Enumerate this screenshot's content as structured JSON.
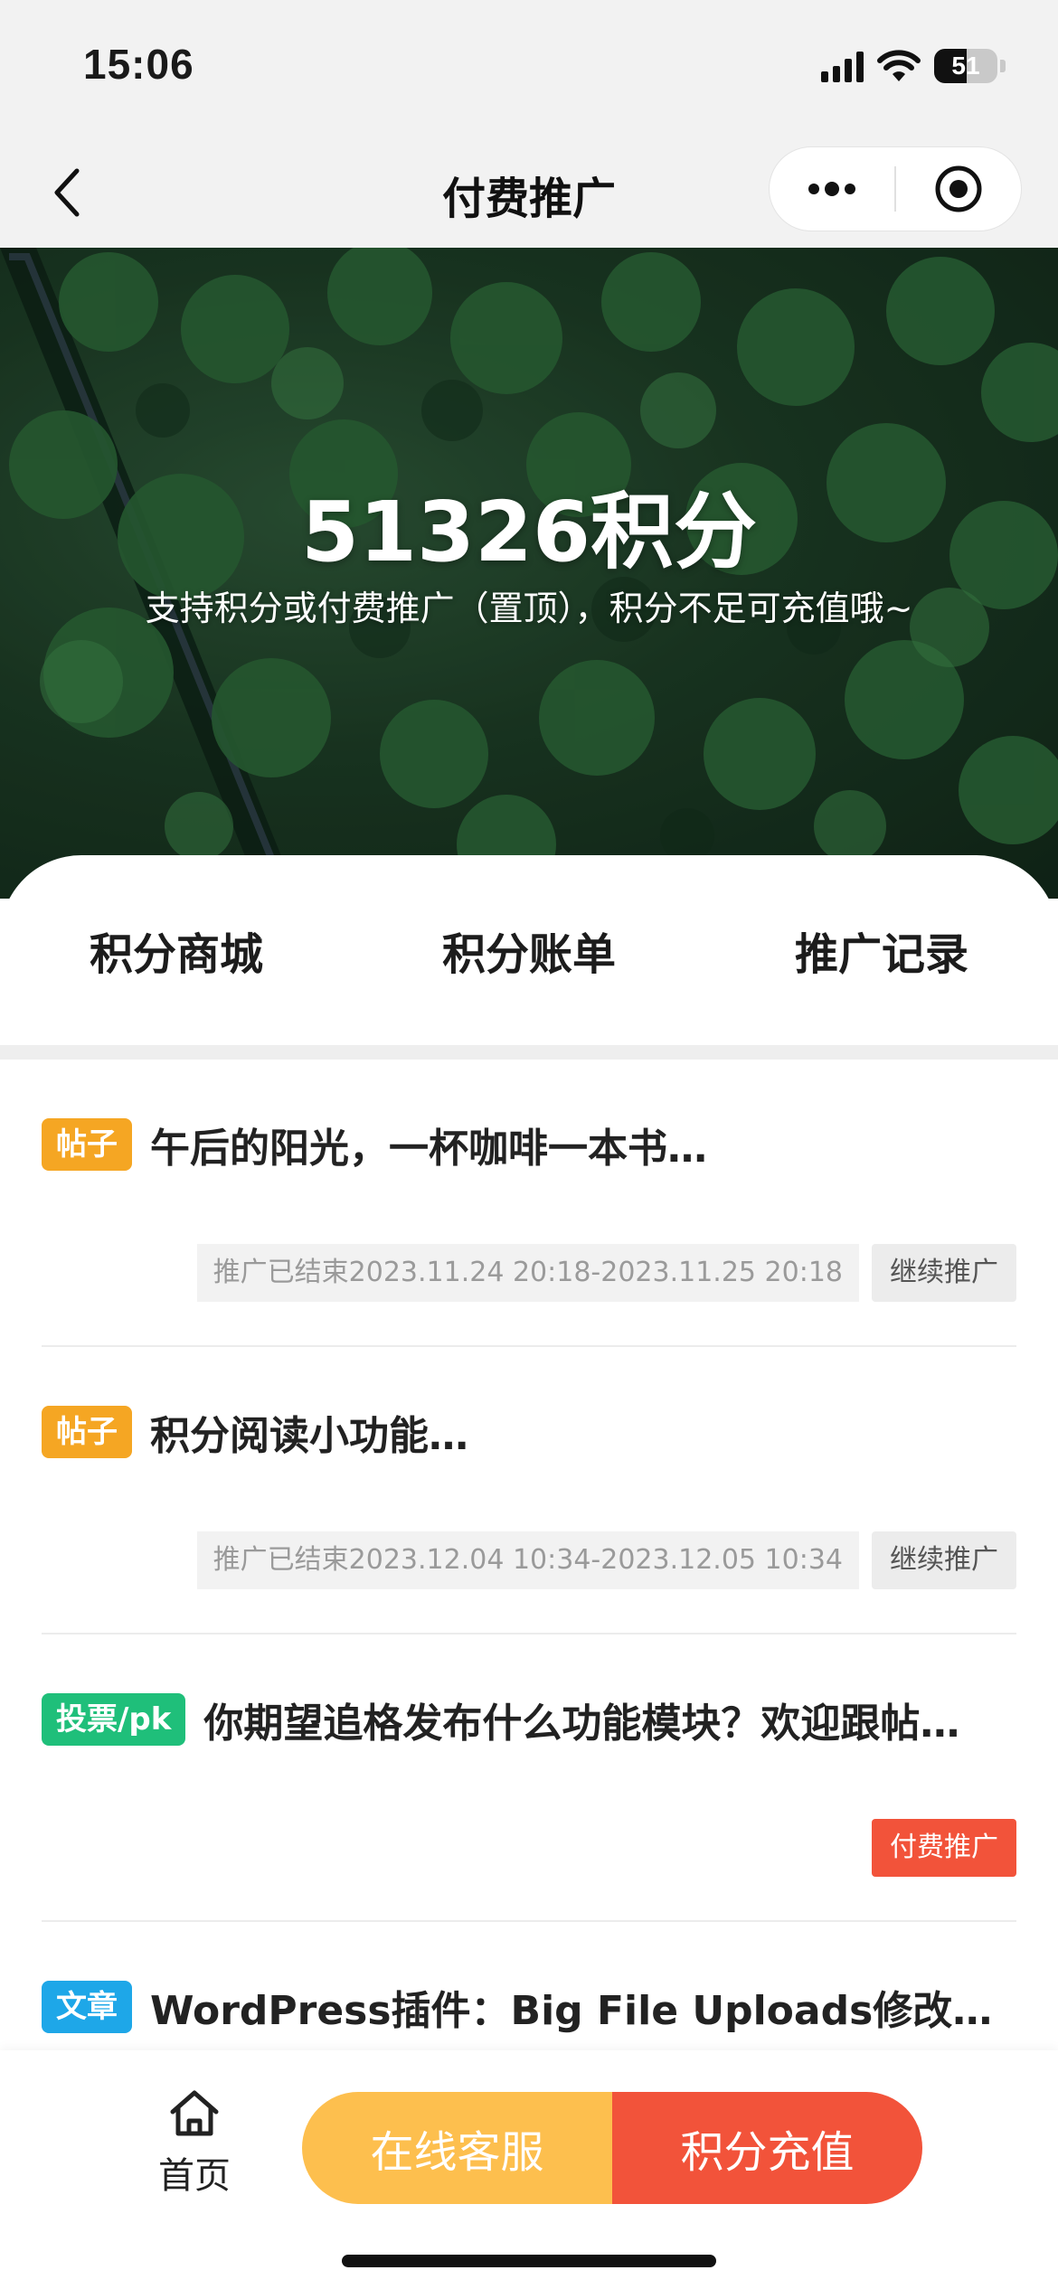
{
  "status_bar": {
    "time": "15:06",
    "battery": "51",
    "battery_level": 0.51,
    "icons": [
      "signal-icon",
      "wifi-icon",
      "battery-icon"
    ]
  },
  "nav": {
    "title": "付费推广",
    "icons": [
      "back-icon",
      "more-icon",
      "close-mini-program-icon"
    ]
  },
  "hero": {
    "points": "51326积分",
    "subtitle": "支持积分或付费推广（置顶），积分不足可充值哦~"
  },
  "menu": [
    {
      "label": "积分商城"
    },
    {
      "label": "积分账单"
    },
    {
      "label": "推广记录"
    }
  ],
  "list": [
    {
      "tag": "帖子",
      "tag_color": "#f5a623",
      "title": "午后的阳光，一杯咖啡一本书…",
      "period": "推广已结束2023.11.24 20:18-2023.11.25 20:18",
      "action": "继续推广"
    },
    {
      "tag": "帖子",
      "tag_color": "#f5a623",
      "title": "积分阅读小功能…",
      "period": "推广已结束2023.12.04 10:34-2023.12.05 10:34",
      "action": "继续推广"
    },
    {
      "tag": "投票/pk",
      "tag_color": "#1fbf7a",
      "title": "你期望追格发布什么功能模块？欢迎跟帖…",
      "period": "",
      "action": "付费推广"
    },
    {
      "tag": "文章",
      "tag_color": "#1ea7e8",
      "title": "WordPress插件：Big File Uploads修改上传…",
      "period": "",
      "action": ""
    }
  ],
  "bottom": {
    "home_label": "首页",
    "service_label": "在线客服",
    "recharge_label": "积分充值",
    "colors": {
      "service": "#fdbf4e",
      "recharge": "#f2533a"
    }
  }
}
